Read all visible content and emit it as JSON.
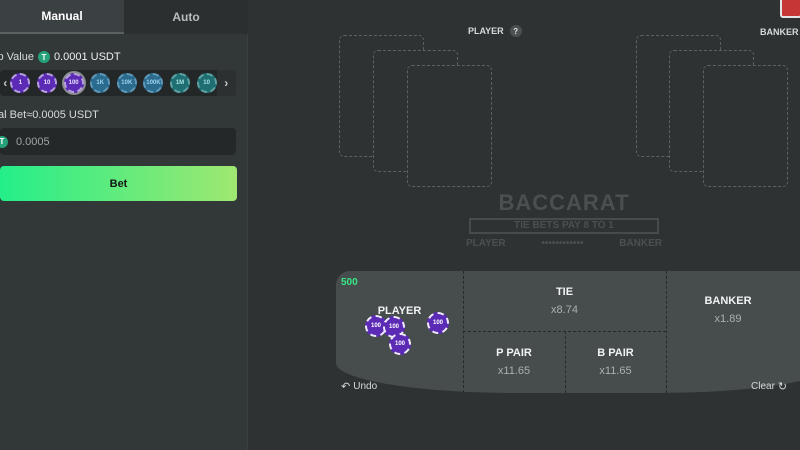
{
  "tabs": [
    {
      "label": "Manual",
      "active": true
    },
    {
      "label": "Auto",
      "active": false
    }
  ],
  "chip_value": {
    "label_prefix": "ip Value",
    "value": "0.0001 USDT"
  },
  "chips": [
    {
      "label": "1",
      "color": "purple"
    },
    {
      "label": "10",
      "color": "purple"
    },
    {
      "label": "100",
      "color": "purple",
      "selected": true
    },
    {
      "label": "1K",
      "color": "blue"
    },
    {
      "label": "10K",
      "color": "blue"
    },
    {
      "label": "100K",
      "color": "blue"
    },
    {
      "label": "1M",
      "color": "teal"
    },
    {
      "label": "10",
      "color": "teal"
    }
  ],
  "total_bet": {
    "label_prefix": "tal Bet",
    "approx": "≈0.0005 USDT",
    "input_value": "0.0005"
  },
  "bet_button": "Bet",
  "player_label": "PLAYER",
  "banker_label": "BANKER",
  "help_symbol": "?",
  "watermark": {
    "title": "BACCARAT",
    "ribbon": "TIE BETS PAY 8 TO 1",
    "left": "PLAYER",
    "dots": "••••••••••••",
    "right": "BANKER"
  },
  "table": {
    "stake": "500",
    "player": {
      "name": "PLAYER"
    },
    "tie": {
      "name": "TIE",
      "odds": "x8.74"
    },
    "banker": {
      "name": "BANKER",
      "odds": "x1.89"
    },
    "p_pair": {
      "name": "P PAIR",
      "odds": "x11.65"
    },
    "b_pair": {
      "name": "B PAIR",
      "odds": "x11.65"
    },
    "placed_chips": [
      "100",
      "100",
      "100",
      "100"
    ]
  },
  "undo_label": "Undo",
  "clear_label": "Clear",
  "colors": {
    "accent_green": "#24ee89",
    "accent_lime": "#9fe871",
    "chip_purple": "#5b2bb5",
    "usdt": "#26a17b"
  },
  "icons": [
    "usdt-icon",
    "chevron-left-icon",
    "chevron-right-icon",
    "help-icon",
    "undo-icon",
    "clear-icon"
  ]
}
